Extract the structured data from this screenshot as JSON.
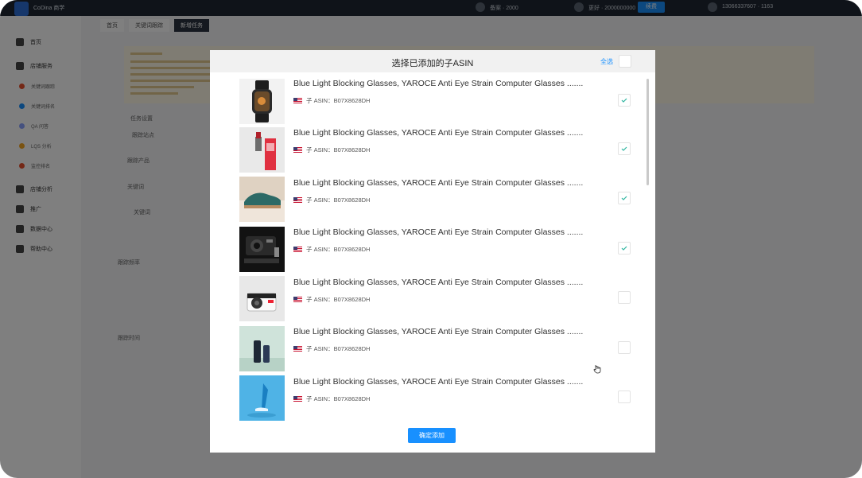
{
  "topbar": {
    "brand": "CoDina 商学",
    "items": [
      "备案 · 2000",
      "更好 · 2000000000",
      "13066337607 · 1163"
    ],
    "button_label": "续费"
  },
  "sidebar": {
    "items": [
      {
        "label": "首页"
      },
      {
        "label": "店铺服务"
      },
      {
        "label": "店铺分析"
      },
      {
        "label": "推广"
      },
      {
        "label": "数据中心"
      },
      {
        "label": "帮助中心"
      }
    ],
    "subitems": [
      {
        "label": "关键词跟踪",
        "color": "#e8502d"
      },
      {
        "label": "关键词排名",
        "color": "#1890ff"
      },
      {
        "label": "QA 问答",
        "color": "#8aa2ff"
      },
      {
        "label": "LQS 分析",
        "color": "#f5a623"
      },
      {
        "label": "监控排名",
        "color": "#e8502d"
      }
    ]
  },
  "main": {
    "tabs": [
      "首页",
      "关键词跟踪",
      "新增任务"
    ],
    "form_labels": [
      "任务设置",
      "跟踪站点",
      "跟踪产品",
      "关键词",
      "关键词",
      "跟踪频率",
      "跟踪时间"
    ]
  },
  "modal": {
    "title": "选择已添加的子ASIN",
    "select_all": "全选",
    "confirm_label": "确定添加",
    "products": [
      {
        "title": "Blue Light Blocking Glasses, YAROCE Anti Eye Strain Computer Glasses .......",
        "asin": "子 ASIN：B07X8628DH",
        "checked": true,
        "image": "watch"
      },
      {
        "title": "Blue Light Blocking Glasses, YAROCE Anti Eye Strain Computer Glasses .......",
        "asin": "子 ASIN：B07X8628DH",
        "checked": true,
        "image": "lipstick"
      },
      {
        "title": "Blue Light Blocking Glasses, YAROCE Anti Eye Strain Computer Glasses .......",
        "asin": "子 ASIN：B07X8628DH",
        "checked": true,
        "image": "shoe"
      },
      {
        "title": "Blue Light Blocking Glasses, YAROCE Anti Eye Strain Computer Glasses .......",
        "asin": "子 ASIN：B07X8628DH",
        "checked": true,
        "image": "camera-gear"
      },
      {
        "title": "Blue Light Blocking Glasses, YAROCE Anti Eye Strain Computer Glasses .......",
        "asin": "子 ASIN：B07X8628DH",
        "checked": false,
        "image": "instant-camera"
      },
      {
        "title": "Blue Light Blocking Glasses, YAROCE Anti Eye Strain Computer Glasses .......",
        "asin": "子 ASIN：B07X8628DH",
        "checked": false,
        "image": "cosmetics"
      },
      {
        "title": "Blue Light Blocking Glasses, YAROCE Anti Eye Strain Computer Glasses .......",
        "asin": "子 ASIN：B07X8628DH",
        "checked": false,
        "image": "high-heel"
      }
    ]
  },
  "colors": {
    "accent": "#1890ff",
    "check": "#2fb5a0",
    "overlay": "rgba(0,0,0,0.5)"
  }
}
